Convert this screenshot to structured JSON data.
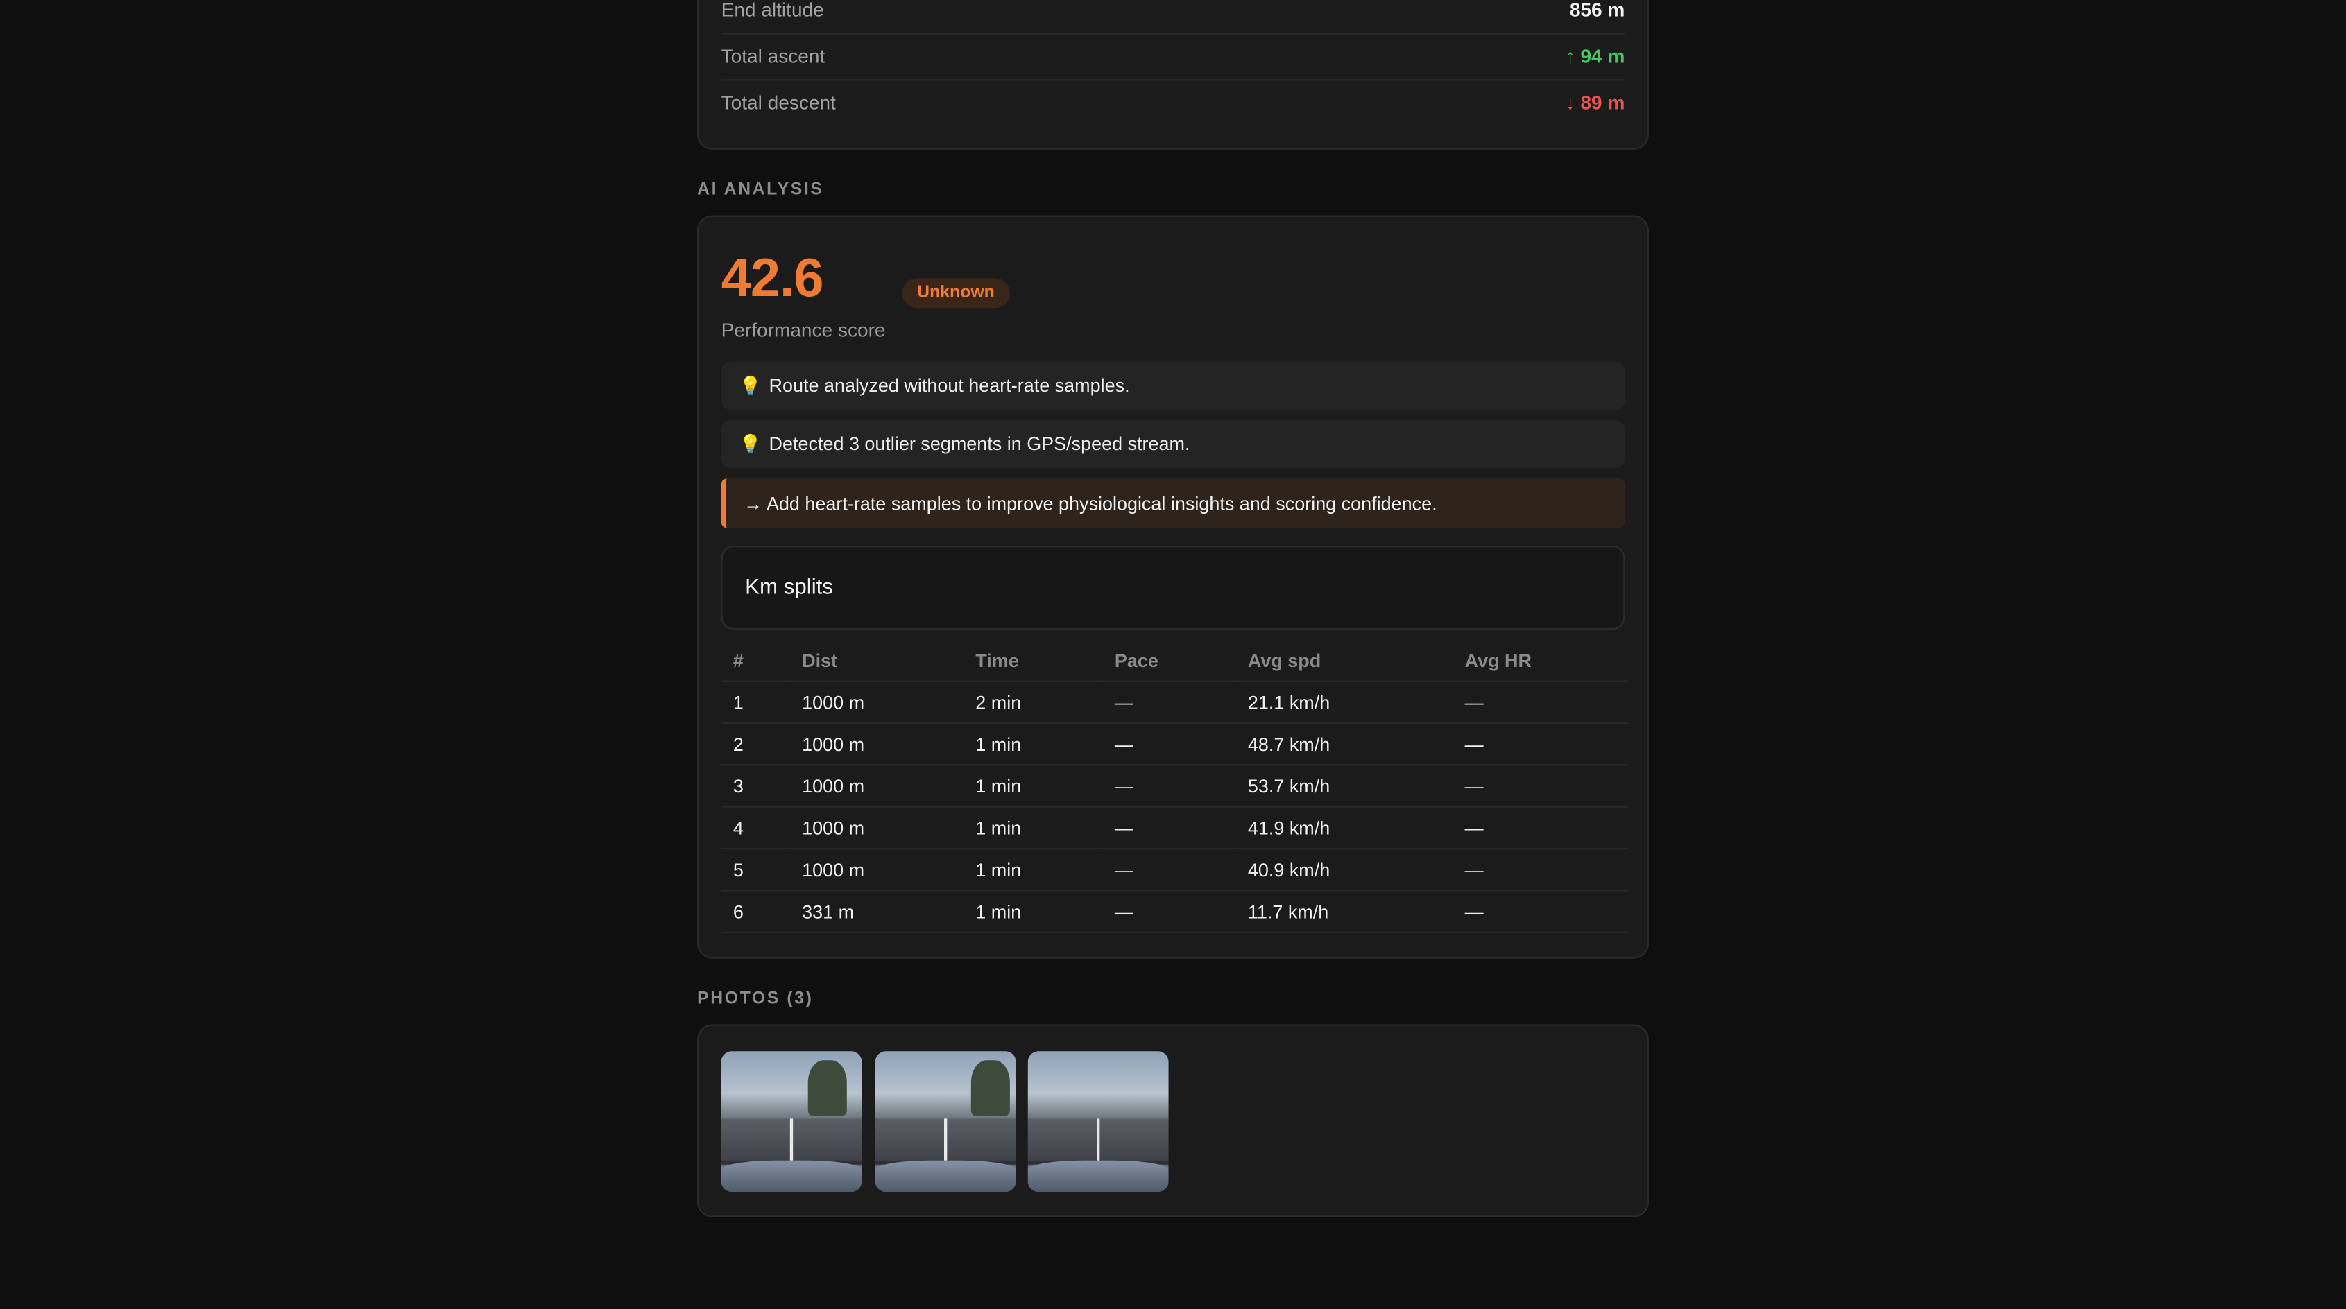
{
  "altitude": {
    "rows": [
      {
        "label": "End altitude",
        "value": "856 m"
      },
      {
        "label": "Total ascent",
        "value": "↑ 94 m"
      },
      {
        "label": "Total descent",
        "value": "↓ 89 m"
      }
    ]
  },
  "ai": {
    "section_title": "AI ANALYSIS",
    "score": "42.6",
    "badge": "Unknown",
    "score_label": "Performance score",
    "insights": [
      "Route analyzed without heart-rate samples.",
      "Detected 3 outlier segments in GPS/speed stream."
    ],
    "recommendation": "→ Add heart-rate samples to improve physiological insights and scoring confidence.",
    "splits_title": "Km splits",
    "columns": [
      "#",
      "Dist",
      "Time",
      "Pace",
      "Avg spd",
      "Avg HR"
    ],
    "rows": [
      [
        "1",
        "1000 m",
        "2 min",
        "—",
        "21.1 km/h",
        "—"
      ],
      [
        "2",
        "1000 m",
        "1 min",
        "—",
        "48.7 km/h",
        "—"
      ],
      [
        "3",
        "1000 m",
        "1 min",
        "—",
        "53.7 km/h",
        "—"
      ],
      [
        "4",
        "1000 m",
        "1 min",
        "—",
        "41.9 km/h",
        "—"
      ],
      [
        "5",
        "1000 m",
        "1 min",
        "—",
        "40.9 km/h",
        "—"
      ],
      [
        "6",
        "331 m",
        "1 min",
        "—",
        "11.7 km/h",
        "—"
      ]
    ]
  },
  "photos": {
    "section_title": "PHOTOS (3)",
    "items": [
      "photo-1",
      "photo-2",
      "photo-3"
    ]
  },
  "colors": {
    "accent": "#f07b35",
    "ascent": "#4cc45f",
    "descent": "#e8544c",
    "background": "#0f0f10",
    "card": "#1b1b1b"
  },
  "icons": {
    "insight": "lightbulb-icon"
  }
}
